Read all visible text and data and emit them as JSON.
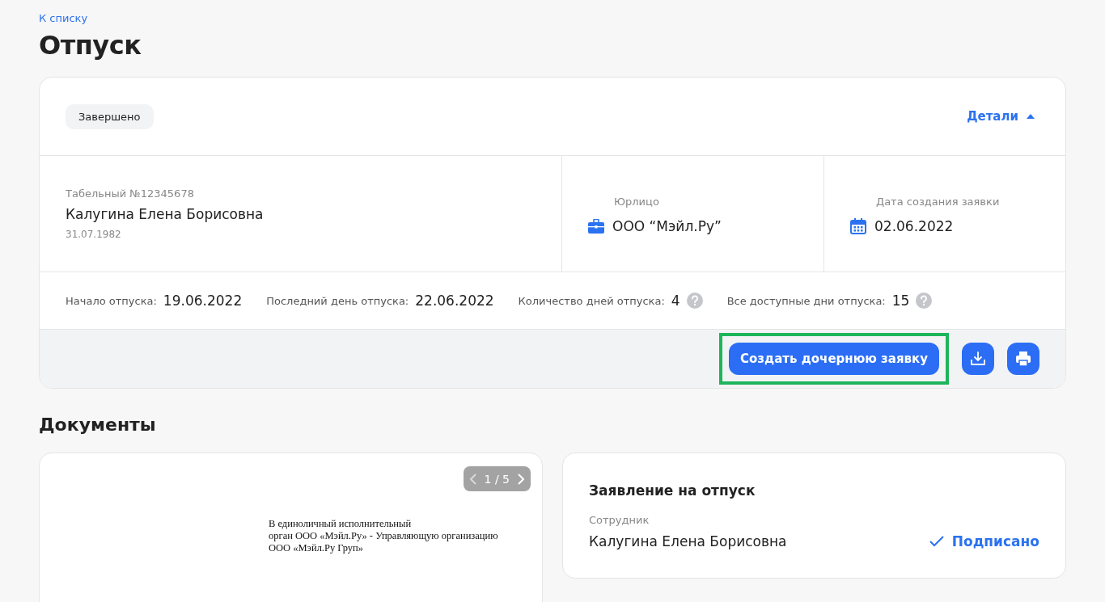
{
  "back_link": "К списку",
  "title": "Отпуск",
  "request": {
    "status": "Завершено",
    "details_toggle": {
      "label": "Детали",
      "expanded": true
    },
    "employee": {
      "number": "Табельный №12345678",
      "name": "Калугина Елена Борисовна",
      "birth_date": "31.07.1982"
    },
    "legal_entity": {
      "label": "Юрлицо",
      "value": "ООО “Мэйл.Ру”"
    },
    "created": {
      "label": "Дата создания заявки",
      "value": "02.06.2022"
    },
    "facts": [
      {
        "label": "Начало отпуска:",
        "value": "19.06.2022",
        "help": false
      },
      {
        "label": "Последний день отпуска:",
        "value": "22.06.2022",
        "help": false
      },
      {
        "label": "Количество дней отпуска:",
        "value": "4",
        "help": true
      },
      {
        "label": "Все доступные дни отпуска:",
        "value": "15",
        "help": true
      }
    ],
    "actions": {
      "create_child": {
        "label": "Создать дочернюю заявку",
        "highlighted": true
      }
    }
  },
  "documents": {
    "title": "Документы",
    "preview": {
      "pager": "1 / 5",
      "lines": [
        "В единоличный исполнительный",
        "орган ООО «Мэйл.Ру» - Управляющую организацию",
        "ООО «Мэйл.Ру Груп»"
      ]
    },
    "card": {
      "title": "Заявление на отпуск",
      "role": "Сотрудник",
      "name": "Калугина Елена Борисовна",
      "signed": true,
      "status": "Подписано"
    }
  }
}
